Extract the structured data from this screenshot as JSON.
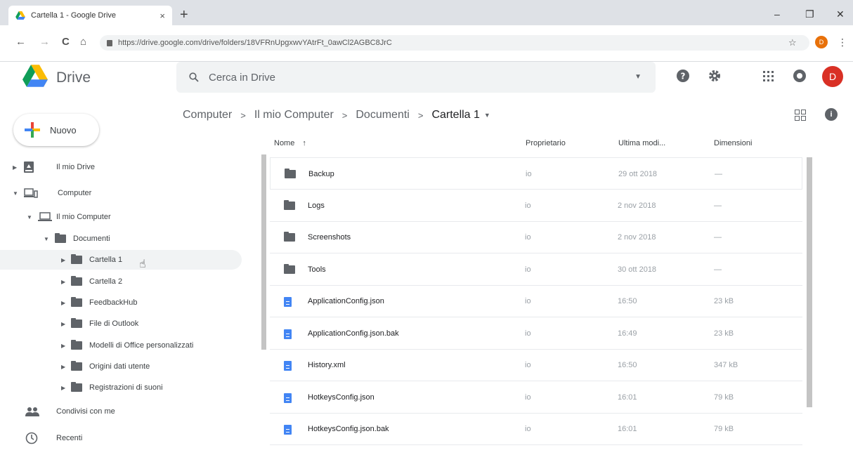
{
  "browser": {
    "tab_title": "Cartella 1 - Google Drive",
    "tab_close": "×",
    "new_tab": "+",
    "url": "https://drive.google.com/drive/folders/18VFRnUpgxwvYAtrFt_0awCl2AGBC8JrC",
    "profile_initial": "D",
    "win_minimize": "–",
    "win_restore": "❐",
    "win_close": "✕",
    "back": "←",
    "forward": "→",
    "reload": "C",
    "home": "⌂",
    "star": "☆",
    "menu": "⋮"
  },
  "header": {
    "app_name": "Drive",
    "search_placeholder": "Cerca in Drive",
    "search_caret": "▼",
    "user_initial": "D"
  },
  "new_button": {
    "label": "Nuovo"
  },
  "sidebar": {
    "items": [
      {
        "label": "Il mio Drive",
        "toggle": "▶"
      },
      {
        "label": "Computer",
        "toggle": "▼"
      },
      {
        "label": "Il mio Computer",
        "toggle": "▼"
      },
      {
        "label": "Documenti",
        "toggle": "▼"
      },
      {
        "label": "Cartella 1",
        "toggle": "▶"
      },
      {
        "label": "Cartella 2",
        "toggle": "▶"
      },
      {
        "label": "FeedbackHub",
        "toggle": "▶"
      },
      {
        "label": "File di Outlook",
        "toggle": "▶"
      },
      {
        "label": "Modelli di Office personalizzati",
        "toggle": "▶"
      },
      {
        "label": "Origini dati utente",
        "toggle": "▶"
      },
      {
        "label": "Registrazioni di suoni",
        "toggle": "▶"
      },
      {
        "label": "Condivisi con me"
      },
      {
        "label": "Recenti"
      }
    ]
  },
  "breadcrumb": {
    "items": [
      "Computer",
      "Il mio Computer",
      "Documenti",
      "Cartella 1"
    ],
    "separator": ">",
    "dropdown": "▼"
  },
  "info_label": "i",
  "columns": {
    "name": "Nome",
    "sort": "↑",
    "owner": "Proprietario",
    "modified": "Ultima modi...",
    "size": "Dimensioni"
  },
  "files": [
    {
      "name": "Backup",
      "owner": "io",
      "modified": "29 ott 2018",
      "size": "—",
      "type": "folder"
    },
    {
      "name": "Logs",
      "owner": "io",
      "modified": "2 nov 2018",
      "size": "—",
      "type": "folder"
    },
    {
      "name": "Screenshots",
      "owner": "io",
      "modified": "2 nov 2018",
      "size": "—",
      "type": "folder"
    },
    {
      "name": "Tools",
      "owner": "io",
      "modified": "30 ott 2018",
      "size": "—",
      "type": "folder"
    },
    {
      "name": "ApplicationConfig.json",
      "owner": "io",
      "modified": "16:50",
      "size": "23 kB",
      "type": "doc"
    },
    {
      "name": "ApplicationConfig.json.bak",
      "owner": "io",
      "modified": "16:49",
      "size": "23 kB",
      "type": "doc"
    },
    {
      "name": "History.xml",
      "owner": "io",
      "modified": "16:50",
      "size": "347 kB",
      "type": "doc"
    },
    {
      "name": "HotkeysConfig.json",
      "owner": "io",
      "modified": "16:01",
      "size": "79 kB",
      "type": "doc"
    },
    {
      "name": "HotkeysConfig.json.bak",
      "owner": "io",
      "modified": "16:01",
      "size": "79 kB",
      "type": "doc"
    }
  ]
}
